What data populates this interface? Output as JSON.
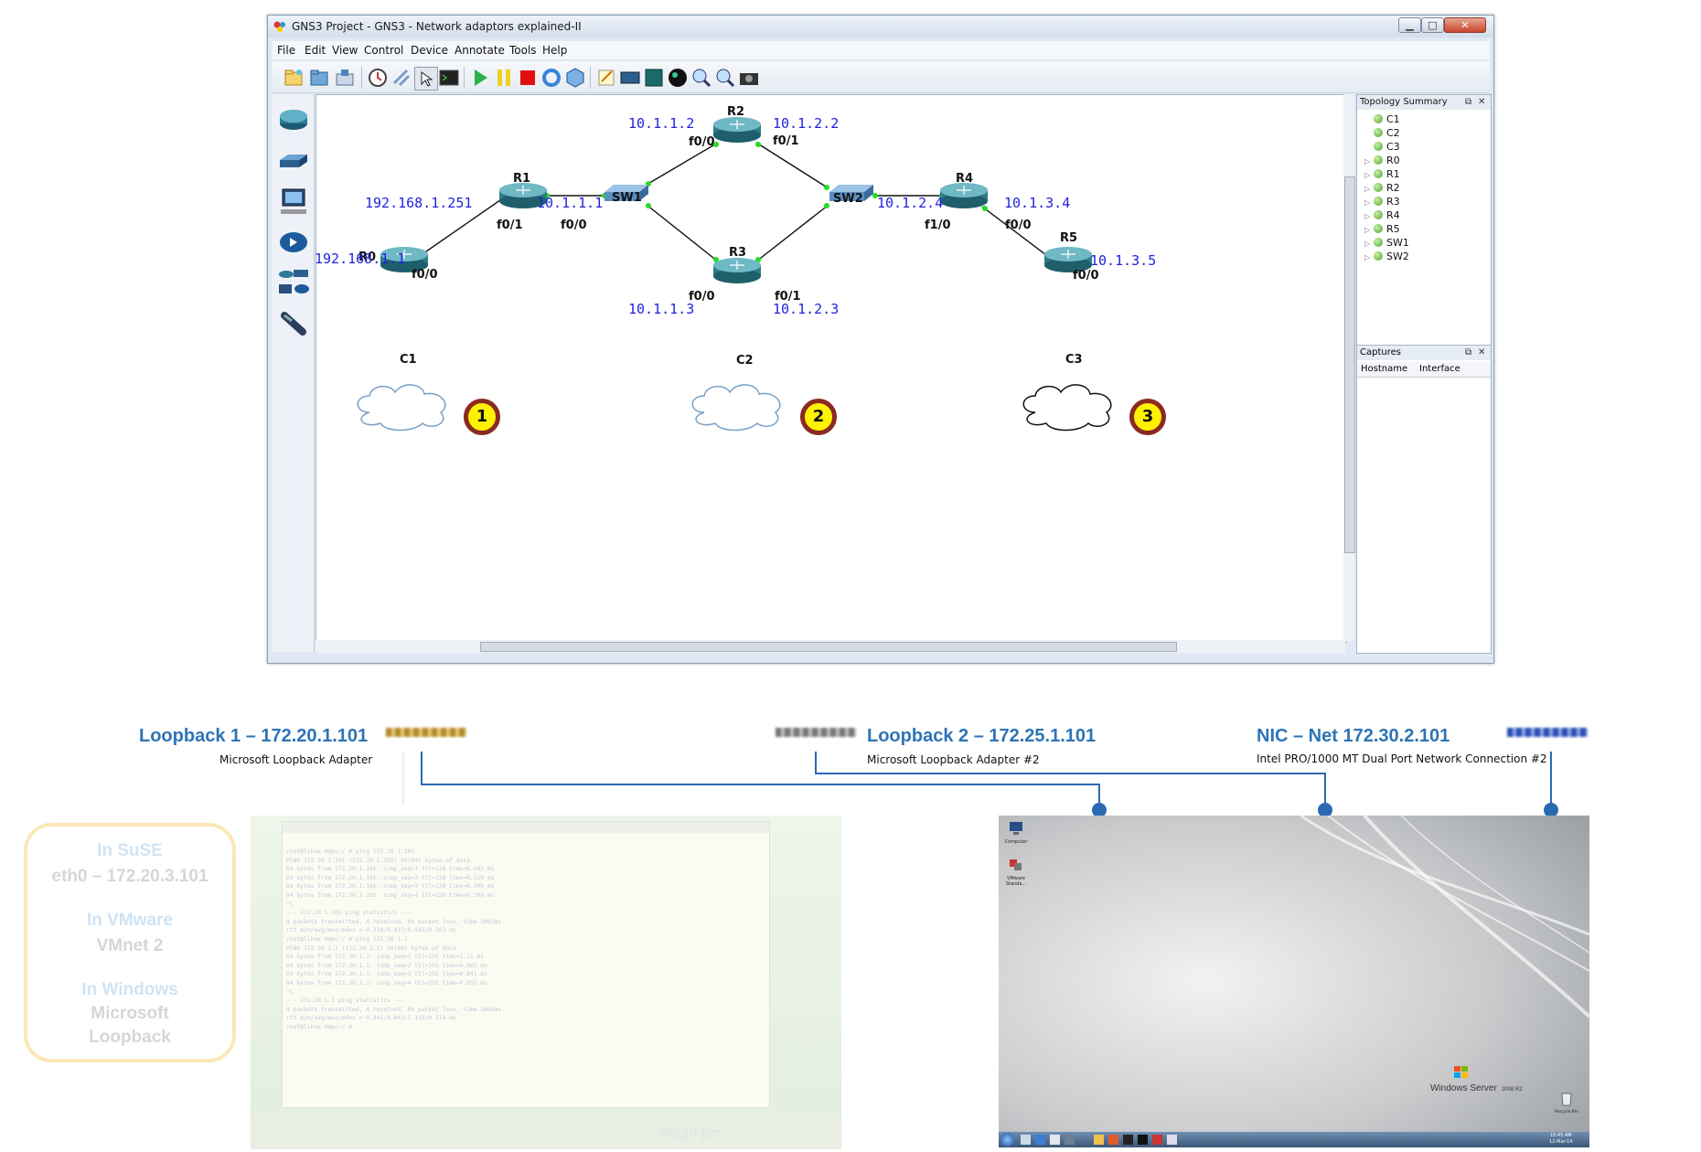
{
  "window": {
    "title": "GNS3 Project - GNS3 - Network adaptors explained-II",
    "menu": [
      "File",
      "Edit",
      "View",
      "Control",
      "Device",
      "Annotate",
      "Tools",
      "Help"
    ],
    "close_glyph": "✕",
    "min_glyph": "▁",
    "max_glyph": "□"
  },
  "toolbar_icons": [
    "new-project-icon",
    "open-project-icon",
    "save-project-icon",
    "snapshot-clock-icon",
    "link-icon",
    "select-icon",
    "console-icon",
    "start-icon",
    "pause-icon",
    "stop-icon",
    "reload-icon",
    "virtualbox-icon",
    "note-icon",
    "screenshot-icon",
    "rectangle-icon",
    "ellipse-icon",
    "zoom-in-icon",
    "zoom-out-icon",
    "camera-icon"
  ],
  "left_dock_icons": [
    "router-icon",
    "switch-icon",
    "end-device-icon",
    "security-device-icon",
    "all-devices-icon",
    "add-link-icon"
  ],
  "topology_summary": {
    "title": "Topology Summary",
    "items": [
      {
        "name": "C1",
        "expandable": false
      },
      {
        "name": "C2",
        "expandable": false
      },
      {
        "name": "C3",
        "expandable": false
      },
      {
        "name": "R0",
        "expandable": true
      },
      {
        "name": "R1",
        "expandable": true
      },
      {
        "name": "R2",
        "expandable": true
      },
      {
        "name": "R3",
        "expandable": true
      },
      {
        "name": "R4",
        "expandable": true
      },
      {
        "name": "R5",
        "expandable": true
      },
      {
        "name": "SW1",
        "expandable": true
      },
      {
        "name": "SW2",
        "expandable": true
      }
    ]
  },
  "captures": {
    "title": "Captures",
    "columns": [
      "Hostname",
      "Interface"
    ]
  },
  "topology": {
    "nodes": {
      "r0": "R0",
      "r1": "R1",
      "r2": "R2",
      "r3": "R3",
      "r4": "R4",
      "r5": "R5",
      "sw1": "SW1",
      "sw2": "SW2",
      "c1": "C1",
      "c2": "C2",
      "c3": "C3"
    },
    "ips": {
      "r1_left": "192.168.1.251",
      "r0": "192.168.1.1",
      "r1_right": "10.1.1.1",
      "r2_left": "10.1.1.2",
      "r2_right": "10.1.2.2",
      "r3_left": "10.1.1.3",
      "r3_right": "10.1.2.3",
      "r4_left": "10.1.2.4",
      "r4_right": "10.1.3.4",
      "r5": "10.1.3.5"
    },
    "ports": {
      "r0": "f0/0",
      "r1_left": "f0/1",
      "r1_right": "f0/0",
      "r2_left": "f0/0",
      "r2_right": "f0/1",
      "r3_left": "f0/0",
      "r3_right": "f0/1",
      "r4_left": "f1/0",
      "r4_right": "f0/0",
      "r5": "f0/0"
    },
    "badges": [
      "1",
      "2",
      "3"
    ]
  },
  "adapters": [
    {
      "title": "Loopback 1 – 172.20.1.101",
      "subtitle": "Microsoft Loopback Adapter"
    },
    {
      "title": "Loopback 2 – 172.25.1.101",
      "subtitle": "Microsoft Loopback Adapter #2"
    },
    {
      "title": "NIC – Net 172.30.2.101",
      "subtitle": "Intel PRO/1000 MT Dual Port Network Connection #2"
    }
  ],
  "faded_box": {
    "suse_title": "In SuSE",
    "suse_value": "eth0 – 172.20.3.101",
    "vmware_title": "In VMware",
    "vmware_value": "VMnet 2",
    "windows_title": "In Windows",
    "windows_value_1": "Microsoft",
    "windows_value_2": "Loopback"
  },
  "suse_terminal": {
    "time": "06:30 pm",
    "lines": [
      "root@linux-0mpc:/ # ping 172.20.1.101",
      "PING 172.20.1.101 (172.20.1.101) 56(84) bytes of data.",
      "64 bytes from 172.20.1.101: icmp_seq=1 ttl=128 time=0.582 ms",
      "64 bytes from 172.20.1.101: icmp_seq=2 ttl=128 time=0.310 ms",
      "64 bytes from 172.20.1.101: icmp_seq=3 ttl=128 time=0.390 ms",
      "64 bytes from 172.20.1.101: icmp_seq=4 ttl=128 time=0.308 ms",
      "^C",
      "--- 172.20.1.101 ping statistics ---",
      "4 packets transmitted, 4 received, 0% packet loss, time 3001ms",
      "rtt min/avg/max/mdev = 0.310/0.417/0.582/0.102 ms",
      "root@linux-0mpc:/ # ping 172.30.1.1",
      "PING 172.30.1.1 (172.30.1.1) 56(84) bytes of data.",
      "64 bytes from 172.30.1.1: icmp_seq=1 ttl=255 time=1.11 ms",
      "64 bytes from 172.30.1.1: icmp_seq=2 ttl=255 time=0.865 ms",
      "64 bytes from 172.30.1.1: icmp_seq=3 ttl=255 time=0.841 ms",
      "64 bytes from 172.30.1.1: icmp_seq=4 ttl=255 time=0.855 ms",
      "^C",
      "--- 172.30.1.1 ping statistics ---",
      "4 packets transmitted, 4 received, 0% packet loss, time 3004ms",
      "rtt min/avg/max/mdev = 0.841/0.943/1.110/0.114 ms",
      "root@linux-0mpc:/ #"
    ]
  },
  "windows_desktop": {
    "brand": "Windows Server",
    "brand_version": "2008 R2",
    "icon_computer": "Computer",
    "icon_vmware": "VMware Standa...",
    "icon_recycle": "Recycle Bin",
    "clock": "10:45 AM",
    "date": "12-Mar-14"
  }
}
